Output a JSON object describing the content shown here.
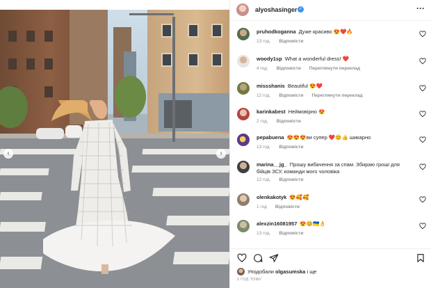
{
  "header": {
    "username": "alyoshasinger",
    "more_icon": "more-horizontal-icon"
  },
  "comments": [
    {
      "user": "pruhodkoganna",
      "text": "Дуже красиво 😍❤️🔥",
      "time": "13 год.",
      "reply": "Відповісти",
      "translate": ""
    },
    {
      "user": "woody1sp",
      "text": "What a wonderful dress! ❤️",
      "time": "4 год.",
      "reply": "Відповісти",
      "translate": "Переглянути переклад"
    },
    {
      "user": "missshanis",
      "text": "Beautiful 😍❤️",
      "time": "12 год.",
      "reply": "Відповісти",
      "translate": "Переглянути переклад"
    },
    {
      "user": "karinkabest",
      "text": "Неймовірно 😍",
      "time": "2 год.",
      "reply": "Відповісти",
      "translate": ""
    },
    {
      "user": "pepabuena",
      "text": "😍😍😍ви супер ❤️😊👍 шикарно",
      "time": "13 год.",
      "reply": "Відповісти",
      "translate": ""
    },
    {
      "user": "marina__jg_",
      "text": "Прошу вибачення за спам. Збираю гроші для бійців ЗСУ, команди мого чоловіка",
      "time": "12 год.",
      "reply": "Відповісти",
      "translate": ""
    },
    {
      "user": "olenkakotyk",
      "text": "😍🥰🥰",
      "time": "1 год",
      "reply": "Відповісти",
      "translate": ""
    },
    {
      "user": "alexzin16081957",
      "text": "😍😊🇺🇦👌",
      "time": "13 год.",
      "reply": "Відповісти",
      "translate": ""
    }
  ],
  "likes": {
    "prefix": "Уподобали",
    "user": "olgasumska",
    "suffix": "і ще"
  },
  "posted_ago": "5 ГОД ТОМУ",
  "colors": {
    "verified": "#3897f0",
    "meta": "#8e8e8e",
    "text": "#262626"
  }
}
